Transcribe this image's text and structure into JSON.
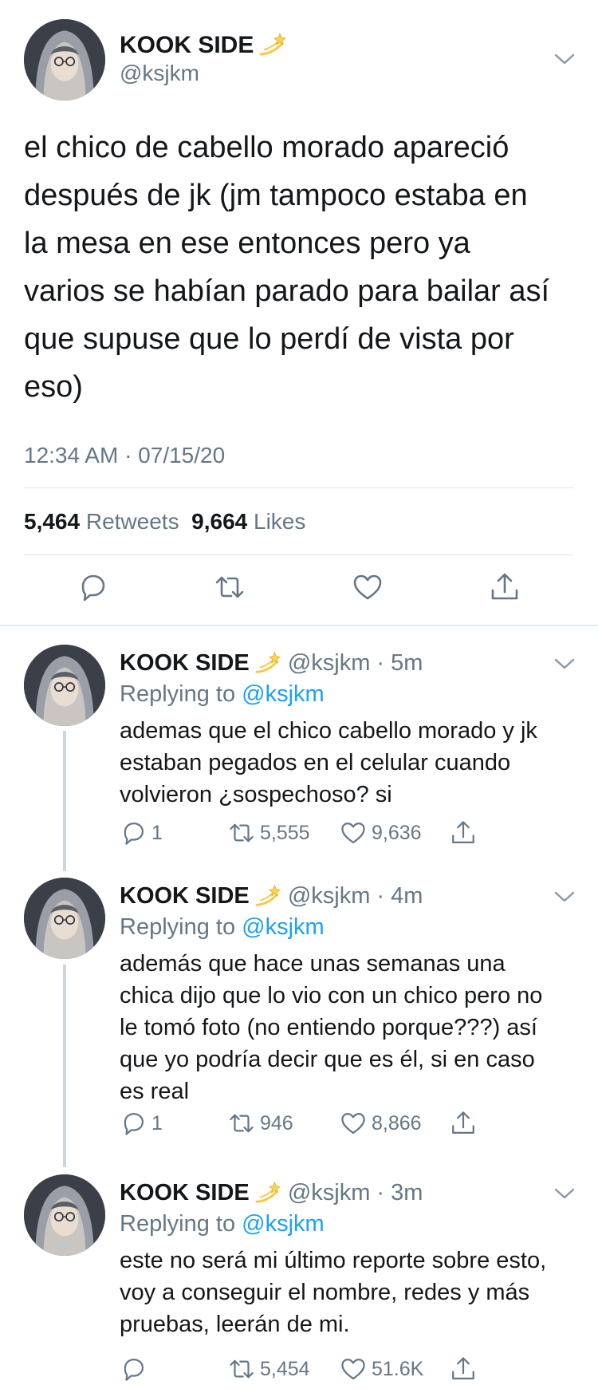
{
  "main_tweet": {
    "display_name": "KOOK SIDE",
    "name_emoji": "dizzy-emoji",
    "handle": "@ksjkm",
    "text": "el chico de cabello morado apareció\ndespués de jk (jm tampoco estaba en\nla mesa en ese entonces pero ya\nvarios se habían parado para bailar así\nque supuse que lo perdí de vista por\neso)",
    "timestamp": "12:34 AM · 07/15/20",
    "retweets_count": "5,464",
    "retweets_label": "Retweets",
    "likes_count": "9,664",
    "likes_label": "Likes",
    "actions": [
      "reply-icon",
      "retweet-icon",
      "like-icon",
      "share-icon"
    ]
  },
  "replies": [
    {
      "display_name": "KOOK SIDE",
      "handle_time": "@ksjkm · 5m",
      "replying_label": "Replying to",
      "replying_to": "@ksjkm",
      "text": "ademas que el chico cabello morado y jk\nestaban pegados en el celular cuando\nvolvieron ¿sospechoso? si",
      "reply_count": "1",
      "retweet_count": "5,555",
      "like_count": "9,636"
    },
    {
      "display_name": "KOOK SIDE",
      "handle_time": "@ksjkm · 4m",
      "replying_label": "Replying to",
      "replying_to": "@ksjkm",
      "text": "además que hace unas semanas una\nchica dijo que lo vio con un chico pero no\nle tomó foto (no entiendo porque???) así\nque yo podría decir que es él, si en caso\nes real",
      "reply_count": "1",
      "retweet_count": "946",
      "like_count": "8,866"
    },
    {
      "display_name": "KOOK SIDE",
      "handle_time": "@ksjkm · 3m",
      "replying_label": "Replying to",
      "replying_to": "@ksjkm",
      "text": "este no será mi último reporte sobre esto,\nvoy a conseguir el nombre, redes y más\npruebas, leerán de mi.",
      "reply_count": "",
      "retweet_count": "5,454",
      "like_count": "51.6K"
    }
  ],
  "colors": {
    "text": "#14171a",
    "secondary": "#657786",
    "link": "#1da1f2",
    "divider": "#e1e8ed",
    "thread_line": "#ccd6dd"
  }
}
